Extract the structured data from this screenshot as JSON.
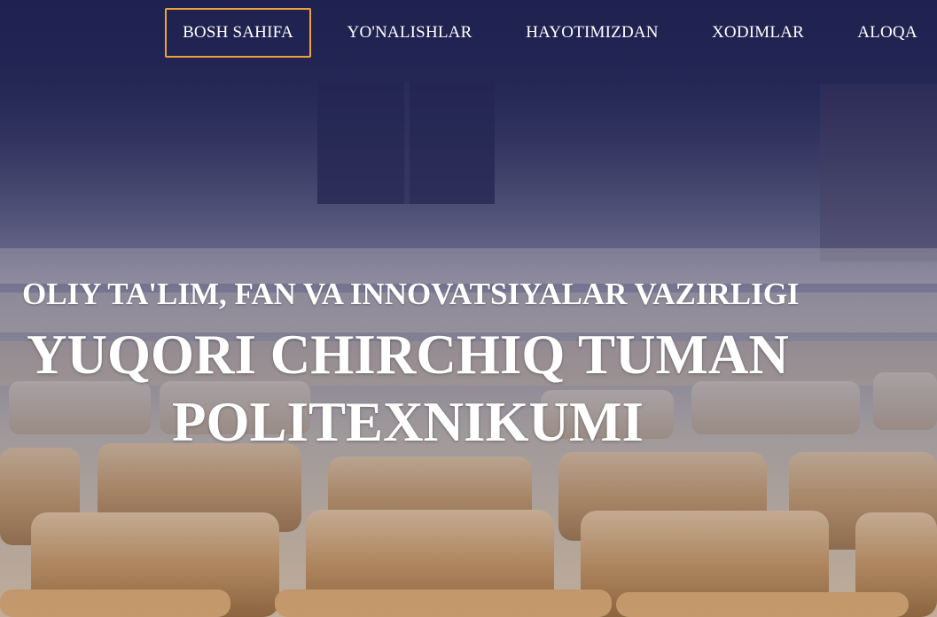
{
  "nav": {
    "items": [
      {
        "label": "BOSH SAHIFA",
        "active": true
      },
      {
        "label": "YO'NALISHLAR",
        "active": false
      },
      {
        "label": "HAYOTIMIZDAN",
        "active": false
      },
      {
        "label": "XODIMLAR",
        "active": false
      },
      {
        "label": "ALOQA",
        "active": false
      }
    ],
    "active_border_color": "#f0a13c"
  },
  "hero": {
    "ministry": "OLIY TA'LIM, FAN VA INNOVATSIYALAR VAZIRLIGI",
    "school_line1": "YUQORI CHIRCHIQ TUMAN",
    "school_line2": "POLITEXNIKUMI",
    "overlay_color": "#1f2150",
    "seat_color": "#b4875a"
  }
}
